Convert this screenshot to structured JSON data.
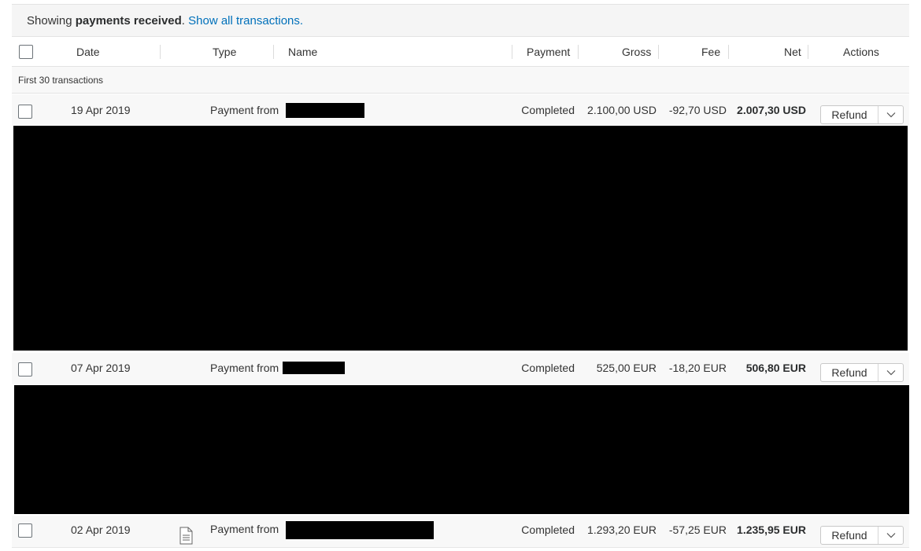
{
  "banner": {
    "prefix": "Showing",
    "bold": "payments received",
    "suffix": ".",
    "link": "Show all transactions."
  },
  "columns": {
    "date": "Date",
    "type": "Type",
    "name": "Name",
    "payment": "Payment",
    "gross": "Gross",
    "fee": "Fee",
    "net": "Net",
    "actions": "Actions"
  },
  "subheader": "First 30 transactions",
  "rows": [
    {
      "date": "19 Apr 2019",
      "type": "Payment from",
      "status": "Completed",
      "gross": "2.100,00 USD",
      "fee": "-92,70 USD",
      "net": "2.007,30 USD",
      "action": "Refund"
    },
    {
      "date": "07 Apr 2019",
      "type": "Payment from",
      "status": "Completed",
      "gross": "525,00 EUR",
      "fee": "-18,20 EUR",
      "net": "506,80 EUR",
      "action": "Refund"
    },
    {
      "date": "02 Apr 2019",
      "type": "Payment from",
      "status": "Completed",
      "gross": "1.293,20 EUR",
      "fee": "-57,25 EUR",
      "net": "1.235,95 EUR",
      "action": "Refund"
    }
  ],
  "icons": {
    "checkbox": "checkbox-icon",
    "chevron": "chevron-down-icon",
    "document": "document-icon"
  },
  "colors": {
    "link": "#0070ba",
    "redaction": "#000000"
  }
}
